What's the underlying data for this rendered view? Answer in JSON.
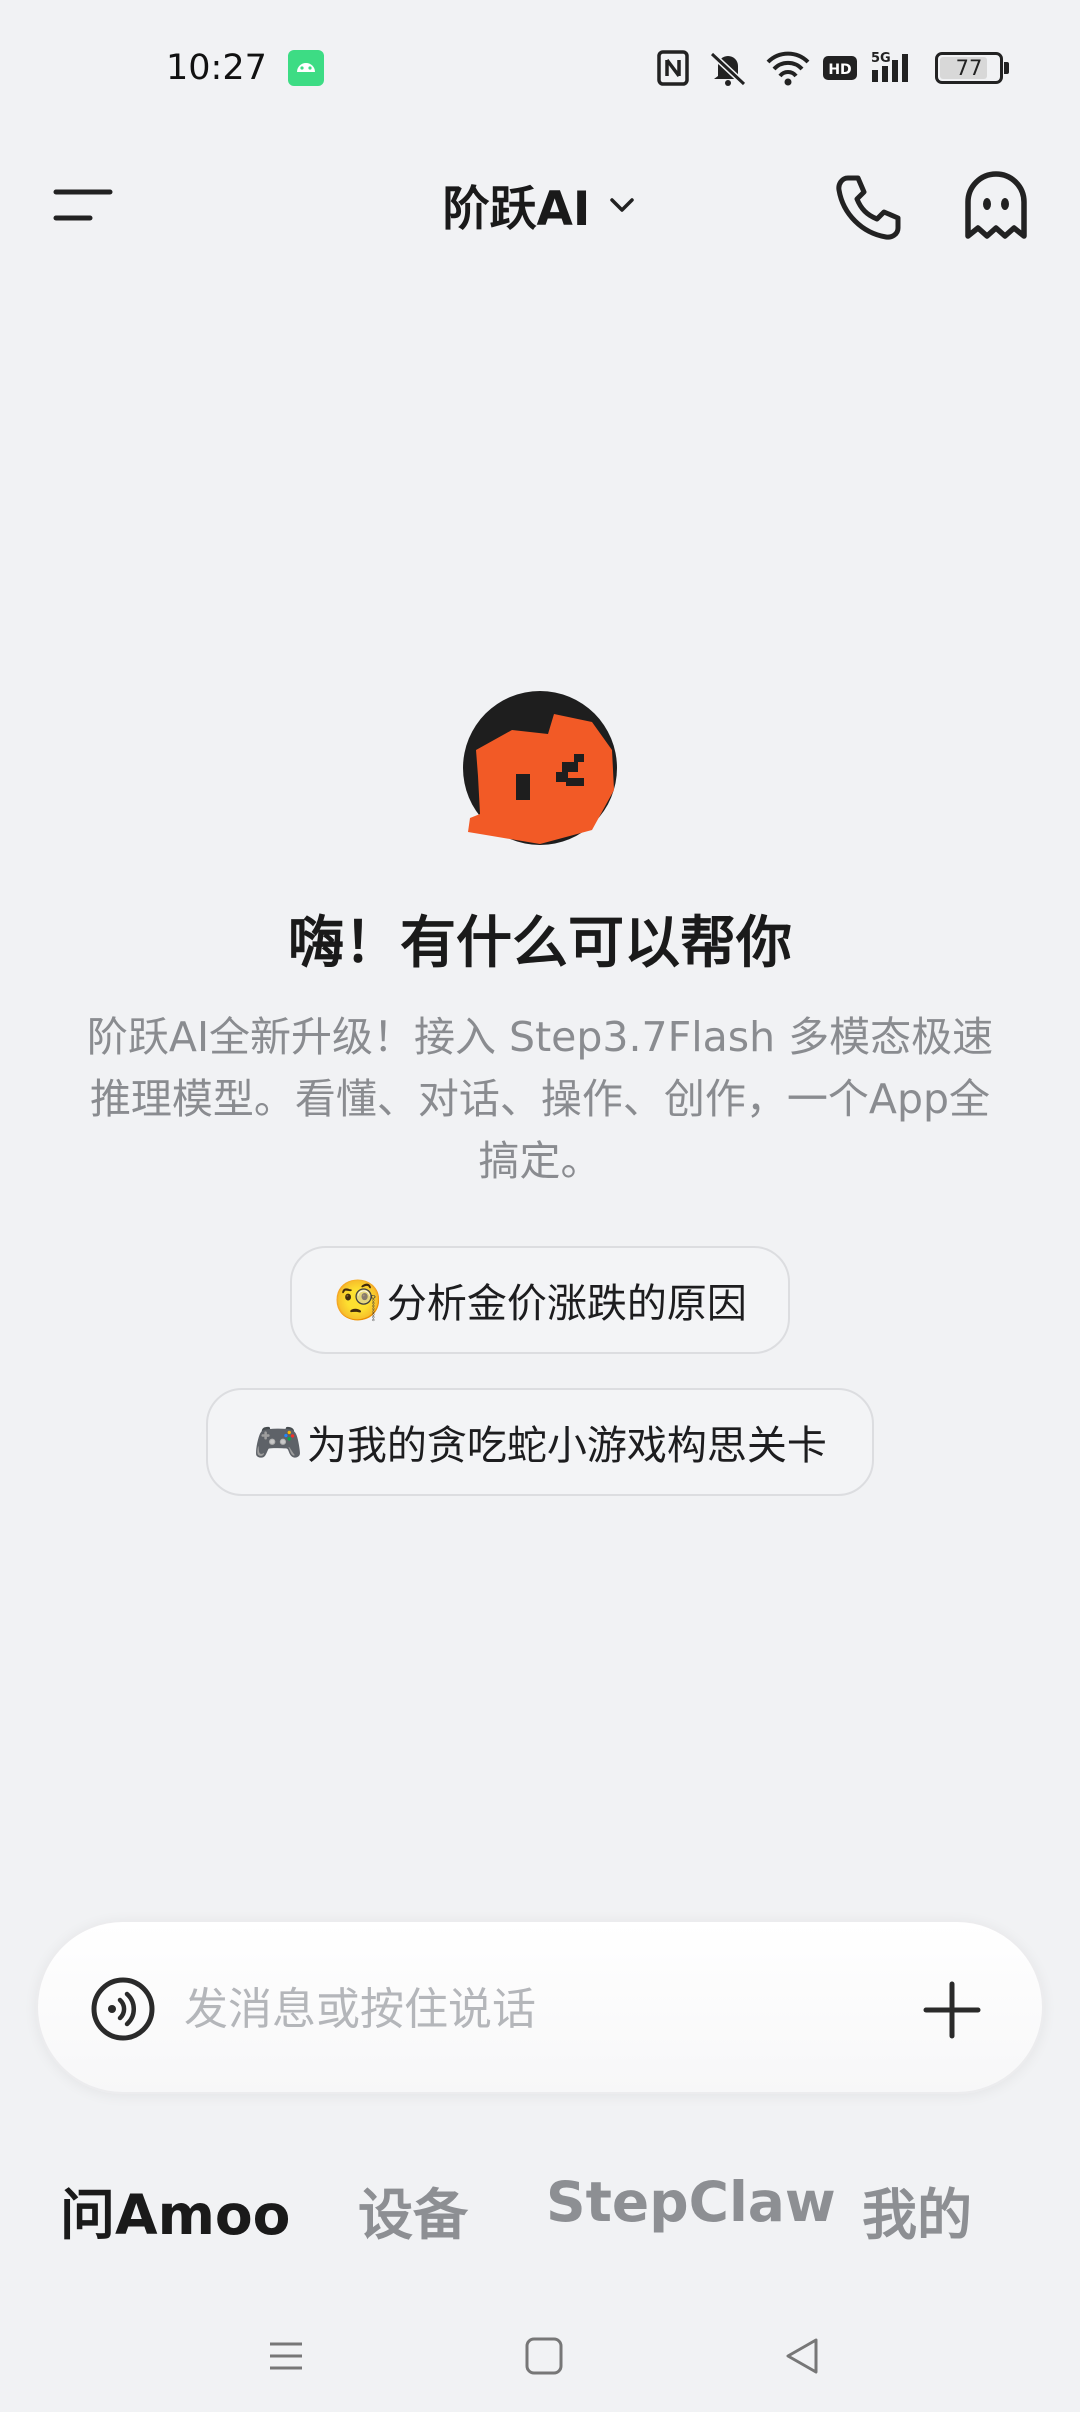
{
  "status_bar": {
    "time": "10:27",
    "battery": "77",
    "icons": [
      "android-icon",
      "nfc-icon",
      "mute-icon",
      "wifi-icon",
      "hd-icon",
      "5g-signal-icon",
      "battery-icon"
    ]
  },
  "header": {
    "title": "阶跃AI",
    "icons": [
      "menu-icon",
      "chevron-down-icon",
      "phone-icon",
      "ghost-icon"
    ]
  },
  "main": {
    "greeting": "嗨！有什么可以帮你",
    "intro": "阶跃AI全新升级！接入 Step3.7Flash 多模态极速推理模型。看懂、对话、操作、创作，一个App全搞定。",
    "suggestions": [
      {
        "emoji": "🧐",
        "label": "分析金价涨跌的原因"
      },
      {
        "emoji": "🎮",
        "label": "为我的贪吃蛇小游戏构思关卡"
      }
    ]
  },
  "input": {
    "placeholder": "发消息或按住说话",
    "icons": [
      "voice-icon",
      "plus-icon"
    ]
  },
  "tabs": [
    {
      "label": "问Amoo",
      "active": true
    },
    {
      "label": "设备",
      "active": false
    },
    {
      "label": "StepClaw",
      "active": false
    },
    {
      "label": "我的",
      "active": false
    }
  ],
  "navbar": {
    "icons": [
      "recents-icon",
      "home-icon",
      "back-icon"
    ]
  },
  "colors": {
    "background": "#f1f2f4",
    "avatar_orange": "#f25a26",
    "avatar_dark": "#1e1e1e",
    "muted_text": "#8a8c90"
  }
}
